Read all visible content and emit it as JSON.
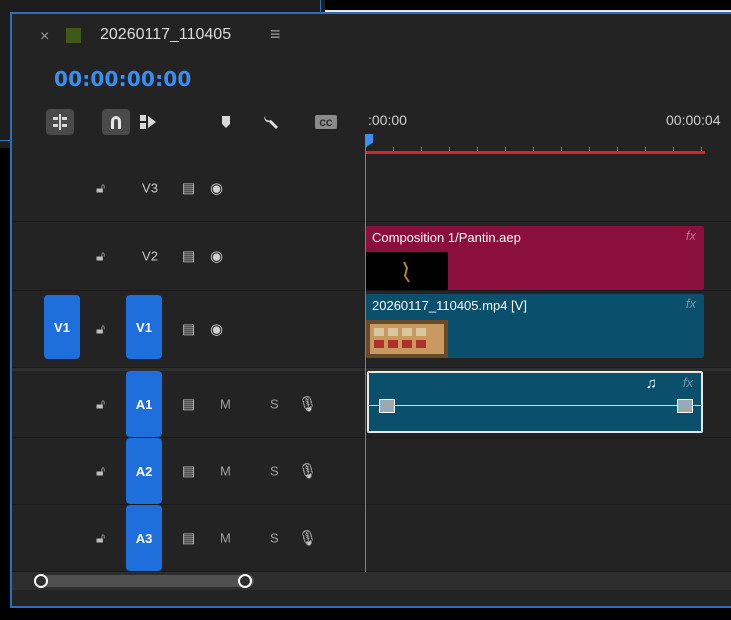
{
  "sequence": {
    "name": "20260117_110405",
    "timecode": "00:00:00:00",
    "color": "#3f5a16"
  },
  "tabbar": {
    "close_glyph": "×",
    "menu_glyph": "≡"
  },
  "toolbar": {
    "icons": [
      "nest-snap-icon",
      "snap-magnet-icon",
      "linked-selection-icon",
      "add-marker-icon",
      "settings-wrench-icon",
      "captions-icon"
    ]
  },
  "ruler": {
    "start_label": ":00:00",
    "end_label": "00:00:04"
  },
  "tracks": {
    "v3": {
      "label": "V3"
    },
    "v2": {
      "label": "V2"
    },
    "v1": {
      "label": "V1",
      "source_label": "V1"
    },
    "a1": {
      "label": "A1",
      "m": "M",
      "s": "S"
    },
    "a2": {
      "label": "A2",
      "m": "M",
      "s": "S"
    },
    "a3": {
      "label": "A3",
      "m": "M",
      "s": "S"
    }
  },
  "clips": {
    "composition": {
      "title": "Composition 1/Pantin.aep",
      "fx": "fx",
      "color": "#8a0f3c"
    },
    "video": {
      "title": "20260117_110405.mp4 [V]",
      "fx": "fx",
      "color": "#0a4f6c"
    },
    "audio": {
      "fx": "fx",
      "color": "#0a4f6c"
    }
  }
}
